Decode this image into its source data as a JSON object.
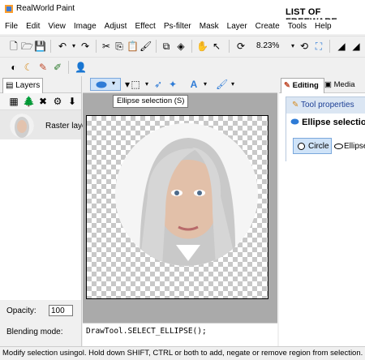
{
  "window": {
    "title": "RealWorld Paint",
    "banner": "LIST OF FREEWARE"
  },
  "menu": [
    "File",
    "Edit",
    "View",
    "Image",
    "Adjust",
    "Effect",
    "Ps-filter",
    "Mask",
    "Layer",
    "Create",
    "Tools",
    "Help"
  ],
  "toolbar": {
    "zoom": "8.23%"
  },
  "layers_panel": {
    "tab": "Layers",
    "layer_name": "Raster layer",
    "opacity_label": "Opacity:",
    "opacity_value": "100",
    "blending_label": "Blending mode:"
  },
  "document": {
    "tooltip": "Ellipse selection (S)",
    "script": "DrawTool.SELECT_ELLIPSE();"
  },
  "right_panel": {
    "tabs": [
      "Editing",
      "Media"
    ],
    "tool_properties_label": "Tool properties",
    "tool_title": "Ellipse selection",
    "shape_options": [
      "Circle",
      "Ellipse"
    ]
  },
  "status": "Modify selection usingol. Hold down SHIFT, CTRL or both to add, negate or remove region from selection.",
  "colors": {
    "accent": "#2e7bd6",
    "selection": "#cfe3f8",
    "panel_header": "#dbe6f3"
  }
}
